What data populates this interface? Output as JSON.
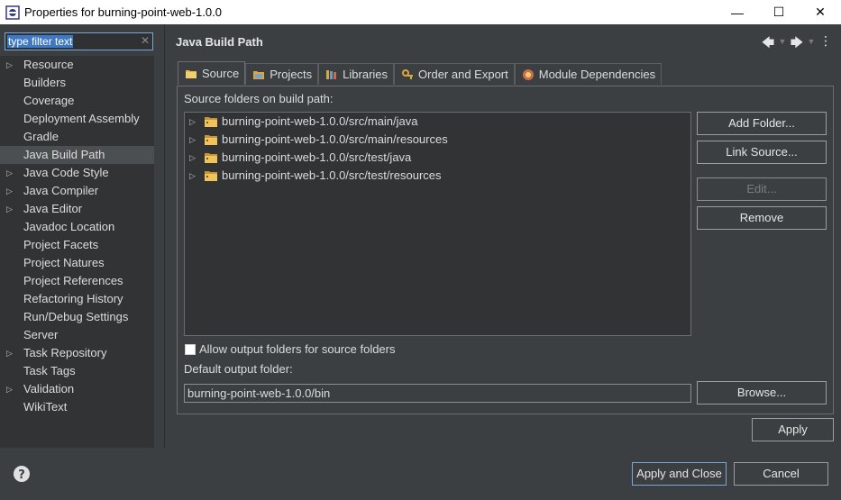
{
  "window": {
    "title": "Properties for burning-point-web-1.0.0",
    "minimize": "—",
    "maximize": "☐",
    "close": "✕"
  },
  "filter": {
    "text": "type filter text",
    "clear": "✕"
  },
  "sidebar": {
    "items": [
      {
        "label": "Resource",
        "expandable": true
      },
      {
        "label": "Builders",
        "expandable": false
      },
      {
        "label": "Coverage",
        "expandable": false
      },
      {
        "label": "Deployment Assembly",
        "expandable": false
      },
      {
        "label": "Gradle",
        "expandable": false
      },
      {
        "label": "Java Build Path",
        "expandable": false,
        "selected": true
      },
      {
        "label": "Java Code Style",
        "expandable": true
      },
      {
        "label": "Java Compiler",
        "expandable": true
      },
      {
        "label": "Java Editor",
        "expandable": true
      },
      {
        "label": "Javadoc Location",
        "expandable": false
      },
      {
        "label": "Project Facets",
        "expandable": false
      },
      {
        "label": "Project Natures",
        "expandable": false
      },
      {
        "label": "Project References",
        "expandable": false
      },
      {
        "label": "Refactoring History",
        "expandable": false
      },
      {
        "label": "Run/Debug Settings",
        "expandable": false
      },
      {
        "label": "Server",
        "expandable": false
      },
      {
        "label": "Task Repository",
        "expandable": true
      },
      {
        "label": "Task Tags",
        "expandable": false
      },
      {
        "label": "Validation",
        "expandable": true
      },
      {
        "label": "WikiText",
        "expandable": false
      }
    ]
  },
  "header": {
    "title": "Java Build Path"
  },
  "tabs": [
    {
      "label": "Source",
      "icon": "source-folder-icon",
      "active": true
    },
    {
      "label": "Projects",
      "icon": "projects-icon"
    },
    {
      "label": "Libraries",
      "icon": "libraries-icon"
    },
    {
      "label": "Order and Export",
      "icon": "order-export-icon"
    },
    {
      "label": "Module Dependencies",
      "icon": "module-dependencies-icon"
    }
  ],
  "source": {
    "list_label": "Source folders on build path:",
    "folders": [
      "burning-point-web-1.0.0/src/main/java",
      "burning-point-web-1.0.0/src/main/resources",
      "burning-point-web-1.0.0/src/test/java",
      "burning-point-web-1.0.0/src/test/resources"
    ],
    "buttons": {
      "add_folder": "Add Folder...",
      "link_source": "Link Source...",
      "edit": "Edit...",
      "remove": "Remove"
    },
    "allow_output_label": "Allow output folders for source folders",
    "allow_output_checked": false,
    "default_output_label": "Default output folder:",
    "default_output_value": "burning-point-web-1.0.0/bin",
    "browse": "Browse..."
  },
  "actions": {
    "apply": "Apply",
    "apply_and_close": "Apply and Close",
    "cancel": "Cancel"
  },
  "colors": {
    "background": "#3b3f42",
    "list_background": "#313335",
    "selection": "#3f78c4",
    "folder": "#e8b84a"
  }
}
